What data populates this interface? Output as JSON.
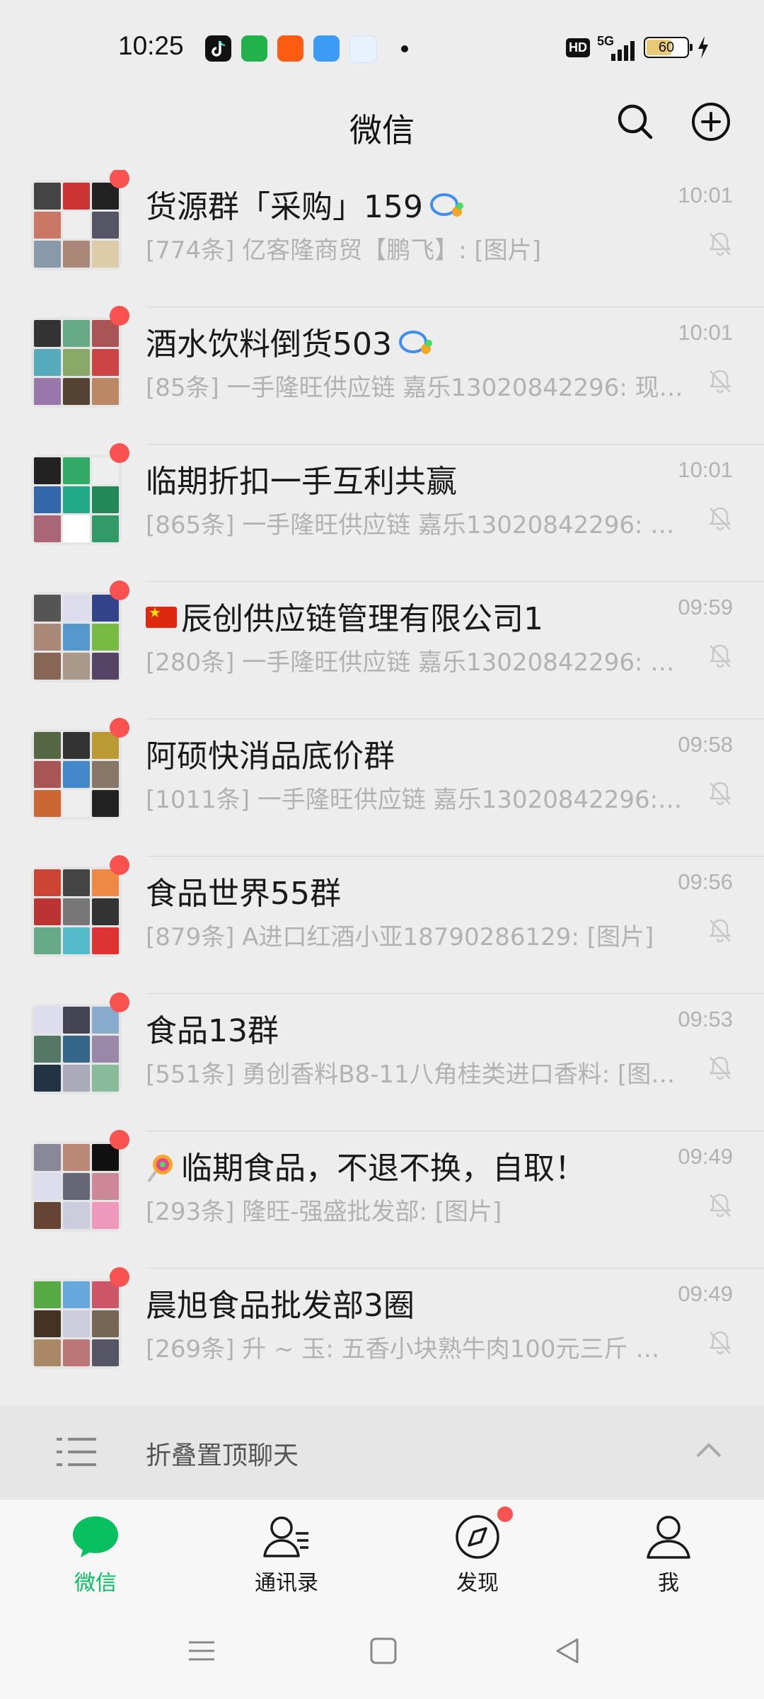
{
  "status_bar": {
    "time": "10:25",
    "hd_label": "HD",
    "network_label": "5G",
    "battery_level": "60",
    "app_icons": [
      "tiktok-icon",
      "green-app-icon",
      "orange-app-icon",
      "weather-icon",
      "blue-app-icon"
    ]
  },
  "header": {
    "title": "微信",
    "search_icon": "search-icon",
    "add_icon": "plus-circle-icon"
  },
  "chats": [
    {
      "name": "货源群「采购」159",
      "time": "10:01",
      "preview": "[774条] 亿客隆商贸【鹏飞】: [图片]",
      "group_tag": true,
      "muted": true,
      "unread_dot": true
    },
    {
      "name": "酒水饮料倒货503",
      "time": "10:01",
      "preview": "[85条] 一手隆旺供应链 嘉乐13020842296: 现金…",
      "group_tag": true,
      "muted": true,
      "unread_dot": true
    },
    {
      "name": "临期折扣一手互利共赢",
      "time": "10:01",
      "preview": "[865条] 一手隆旺供应链 嘉乐13020842296: 现…",
      "muted": true,
      "unread_dot": true
    },
    {
      "name": "辰创供应链管理有限公司1",
      "time": "09:59",
      "preview": "[280条] 一手隆旺供应链 嘉乐13020842296: 现…",
      "prefix_icon": "china-flag-icon",
      "muted": true,
      "unread_dot": true
    },
    {
      "name": "阿硕快消品底价群",
      "time": "09:58",
      "preview": "[1011条] 一手隆旺供应链 嘉乐13020842296: 现…",
      "muted": true,
      "unread_dot": true
    },
    {
      "name": "食品世界55群",
      "time": "09:56",
      "preview": "[879条] A进口红酒小亚18790286129: [图片]",
      "muted": true,
      "unread_dot": true
    },
    {
      "name": "食品13群",
      "time": "09:53",
      "preview": "[551条] 勇创香料B8-11八角桂类进口香料: [图片]",
      "muted": true,
      "unread_dot": true
    },
    {
      "name": "临期食品，不退不换，自取！",
      "time": "09:49",
      "preview": "[293条] 隆旺-强盛批发部: [图片]",
      "prefix_icon": "lollipop-icon",
      "muted": true,
      "unread_dot": true
    },
    {
      "name": "晨旭食品批发部3圈",
      "time": "09:49",
      "preview": "[269条] 升 ~ 玉: 五香小块熟牛肉100元三斤 一块…",
      "muted": true,
      "unread_dot": true
    }
  ],
  "collapse_bar": {
    "label": "折叠置顶聊天",
    "icon": "list-icon",
    "chevron": "chevron-up-icon"
  },
  "bottom_nav": [
    {
      "label": "微信",
      "icon": "chat-bubble-icon",
      "active": true
    },
    {
      "label": "通讯录",
      "icon": "contacts-icon",
      "active": false
    },
    {
      "label": "发现",
      "icon": "compass-icon",
      "active": false,
      "dot": true
    },
    {
      "label": "我",
      "icon": "person-icon",
      "active": false
    }
  ],
  "system_nav": [
    "menu-icon",
    "home-icon",
    "back-icon"
  ],
  "colors": {
    "accent_green": "#07c160",
    "badge_red": "#fa5151",
    "muted_text": "#b2b2b2",
    "background": "#ededed"
  }
}
